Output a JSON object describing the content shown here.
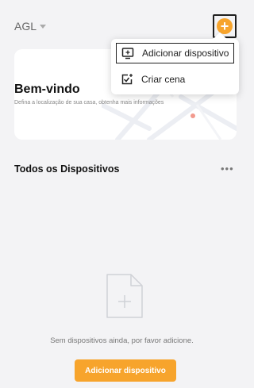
{
  "header": {
    "home_name": "AGL",
    "add_icon": "plus-circle-icon",
    "accent_color": "#f7a42c"
  },
  "welcome": {
    "title": "Bem-vindo",
    "subtitle": "Defina a localização de sua casa, obtenha mais informações"
  },
  "add_menu": {
    "items": [
      {
        "label": "Adicionar dispositivo",
        "icon": "add-device-icon"
      },
      {
        "label": "Criar cena",
        "icon": "create-scene-icon"
      }
    ]
  },
  "devices": {
    "title": "Todos os Dispositivos",
    "more_icon": "more-dots-icon",
    "empty_text": "Sem dispositivos ainda, por favor adicione.",
    "empty_icon": "document-plus-icon",
    "add_button_label": "Adicionar dispositivo"
  }
}
